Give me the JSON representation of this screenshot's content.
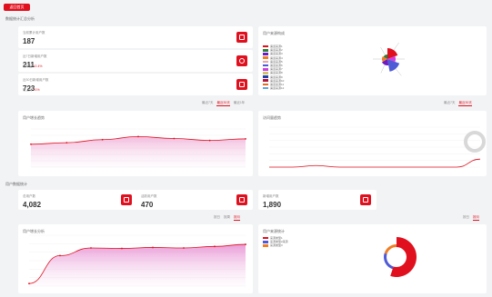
{
  "top_tag": "返回首页",
  "section1": {
    "title": "数据统计汇总分析"
  },
  "stats1": [
    {
      "label": "当前累计用户数",
      "value": "187",
      "sub_label": "",
      "sub_change": ""
    },
    {
      "label": "近7日新增用户数",
      "value": "211",
      "sub_label": "较昨日",
      "sub_change": "+2.4%"
    },
    {
      "label": "近30日新增用户数",
      "value": "723",
      "sub_label": "较上月",
      "sub_change": "+1%"
    }
  ],
  "donut_card": {
    "title": "用户来源构成",
    "legend": [
      {
        "label": "渠道来源1",
        "color": "#e0101e"
      },
      {
        "label": "渠道来源2",
        "color": "#2d7e3a"
      },
      {
        "label": "渠道来源3",
        "color": "#6c1ac2"
      },
      {
        "label": "渠道来源4",
        "color": "#ef7e27"
      },
      {
        "label": "渠道来源5",
        "color": "#e8a6ad"
      },
      {
        "label": "渠道来源6",
        "color": "#4f5ad6"
      },
      {
        "label": "渠道来源7",
        "color": "#cf3ee0"
      },
      {
        "label": "渠道来源8",
        "color": "#d4c26a"
      },
      {
        "label": "渠道来源9",
        "color": "#1c3fa8"
      },
      {
        "label": "渠道来源10",
        "color": "#b0153c"
      },
      {
        "label": "渠道来源11",
        "color": "#e96b1f"
      },
      {
        "label": "渠道来源12",
        "color": "#5fa8d8"
      }
    ]
  },
  "tabs_row1": [
    "最近7天",
    "最近30天",
    "最近1年"
  ],
  "tabs_row1_right": [
    "最近7天",
    "最近30天"
  ],
  "line_card1": {
    "title": "用户增长趋势"
  },
  "line_card2": {
    "title": "访问量趋势"
  },
  "section2": {
    "title": "用户数据统计"
  },
  "stats2": [
    {
      "label": "总用户数",
      "value": "4,082"
    },
    {
      "label": "活跃用户数",
      "value": "470"
    },
    {
      "label": "新增用户数",
      "value": "1,890"
    }
  ],
  "tabs_row2": [
    "按日",
    "按周",
    "按月"
  ],
  "tabs_row2_right": [
    "按日",
    "按月"
  ],
  "area_card": {
    "title": "用户增长分析"
  },
  "donut_card2": {
    "title": "用户来源统计",
    "legend": [
      {
        "label": "来源类型1",
        "color": "#e0101e"
      },
      {
        "label": "来源类型2来源",
        "color": "#4f5ad6"
      },
      {
        "label": "来源类型3",
        "color": "#ef7e27"
      }
    ]
  },
  "chart_data": [
    {
      "type": "line",
      "title": "",
      "series": [
        {
          "values": [
            60,
            64,
            72,
            80,
            75,
            70,
            74
          ]
        }
      ],
      "ylim": [
        0,
        100
      ]
    },
    {
      "type": "line",
      "title": "",
      "series": [
        {
          "values": [
            0,
            0,
            4,
            0,
            0,
            0,
            0,
            0,
            0,
            20
          ]
        }
      ],
      "ylim": [
        0,
        100
      ]
    },
    {
      "type": "area",
      "title": "",
      "series": [
        {
          "values": [
            5,
            60,
            75,
            74,
            76,
            75,
            78,
            82
          ]
        }
      ],
      "ylim": [
        0,
        100
      ]
    },
    {
      "type": "pie",
      "title": "",
      "values": [
        55,
        25,
        20
      ]
    }
  ]
}
